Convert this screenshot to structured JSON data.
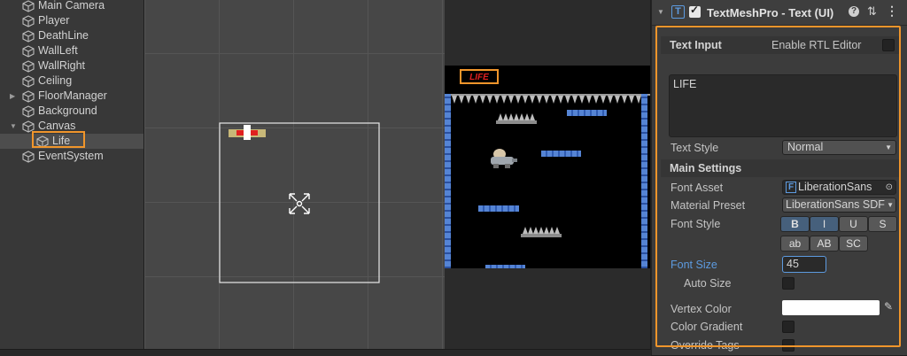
{
  "hierarchy": {
    "items": [
      {
        "label": "Main Camera"
      },
      {
        "label": "Player"
      },
      {
        "label": "DeathLine"
      },
      {
        "label": "WallLeft"
      },
      {
        "label": "WallRight"
      },
      {
        "label": "Ceiling"
      },
      {
        "label": "FloorManager"
      },
      {
        "label": "Background"
      },
      {
        "label": "Canvas"
      },
      {
        "label": "Life"
      },
      {
        "label": "EventSystem"
      }
    ]
  },
  "game": {
    "life_text": "LIFE"
  },
  "inspector": {
    "component_title": "TextMeshPro - Text (UI)",
    "component_icon": "T",
    "text_input": {
      "header": "Text Input",
      "rtl_label": "Enable RTL Editor",
      "rtl_enabled": false,
      "text_value": "LIFE"
    },
    "text_style": {
      "label": "Text Style",
      "value": "Normal"
    },
    "main_settings": {
      "header": "Main Settings",
      "font_asset_label": "Font Asset",
      "font_asset_icon": "F",
      "font_asset_value": "LiberationSans",
      "material_preset_label": "Material Preset",
      "material_preset_value": "LiberationSans SDF",
      "font_style_label": "Font Style",
      "style_buttons_row1": [
        "B",
        "I",
        "U",
        "S"
      ],
      "style_buttons_row2": [
        "ab",
        "AB",
        "SC"
      ],
      "font_size_label": "Font Size",
      "font_size_value": "45",
      "auto_size_label": "Auto Size",
      "auto_size_enabled": false,
      "vertex_color_label": "Vertex Color",
      "vertex_color": "#ffffff",
      "color_gradient_label": "Color Gradient",
      "override_tags_label": "Override Tags"
    }
  },
  "colors": {
    "highlight": "#f0952b",
    "accent_blue": "#5d9be0",
    "life_red": "#e02020"
  }
}
